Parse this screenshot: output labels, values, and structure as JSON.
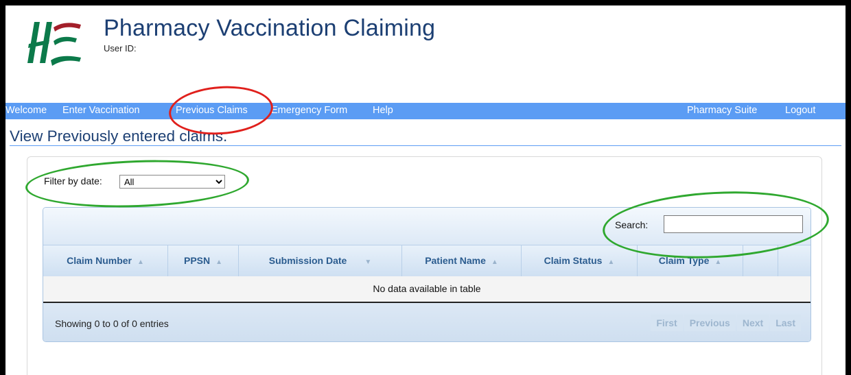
{
  "app": {
    "title": "Pharmacy Vaccination Claiming",
    "user_id_label": "User ID:"
  },
  "nav": {
    "left_items": [
      "Welcome",
      "Enter Vaccination",
      "Previous Claims",
      "Emergency Form",
      "Help"
    ],
    "right_items": [
      "Pharmacy Suite",
      "Logout"
    ]
  },
  "page": {
    "heading": "View Previously entered claims."
  },
  "filter": {
    "label": "Filter by date:",
    "selected": "All"
  },
  "search": {
    "label": "Search:",
    "value": ""
  },
  "table": {
    "columns": [
      "Claim Number",
      "PPSN",
      "Submission Date",
      "Patient Name",
      "Claim Status",
      "Claim Type"
    ],
    "empty_message": "No data available in table",
    "info": "Showing 0 to 0 of 0 entries",
    "pager": [
      "First",
      "Previous",
      "Next",
      "Last"
    ]
  },
  "colors": {
    "nav_bar": "#5b9cf4",
    "title_blue": "#1c3f73",
    "highlight_red": "#e0201c",
    "highlight_green": "#2fa82f",
    "logo_green": "#0c7a4a",
    "logo_red": "#a31f2a"
  }
}
